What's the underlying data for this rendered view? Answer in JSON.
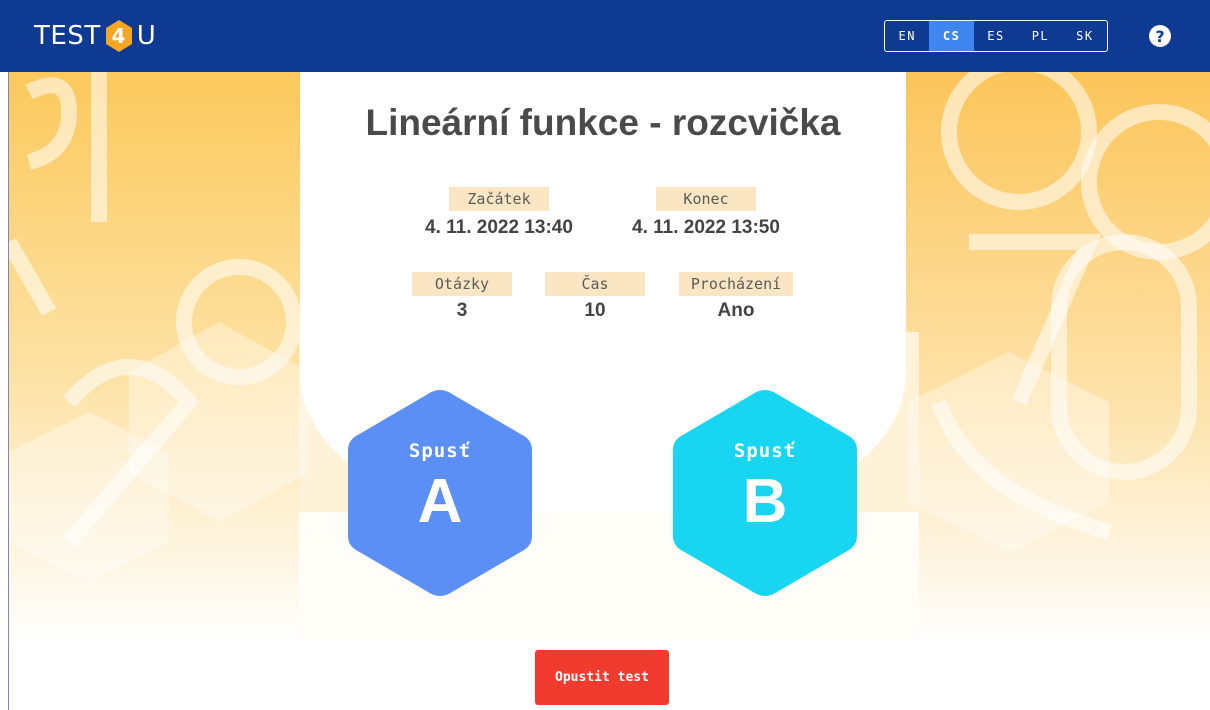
{
  "header": {
    "logo": {
      "left": "TEST",
      "digit": "4",
      "right": "U"
    },
    "languages": [
      {
        "code": "EN",
        "active": false
      },
      {
        "code": "CS",
        "active": true
      },
      {
        "code": "ES",
        "active": false
      },
      {
        "code": "PL",
        "active": false
      },
      {
        "code": "SK",
        "active": false
      }
    ],
    "help_icon": "?"
  },
  "test": {
    "title": "Lineární funkce - rozcvička",
    "start_label": "Začátek",
    "start_value": "4. 11. 2022 13:40",
    "end_label": "Konec",
    "end_value": "4. 11. 2022 13:50",
    "questions_label": "Otázky",
    "questions_value": "3",
    "time_label": "Čas",
    "time_value": "10",
    "browsing_label": "Procházení",
    "browsing_value": "Ano"
  },
  "variants": [
    {
      "label": "Spusť",
      "letter": "A",
      "color": "#5b8ff5"
    },
    {
      "label": "Spusť",
      "letter": "B",
      "color": "#18d6f2"
    }
  ],
  "actions": {
    "leave_label": "Opustit test"
  },
  "colors": {
    "topbar": "#0f3a91",
    "accent": "#3f86f0",
    "tag_bg": "#fbe6c4",
    "leave_button": "#f23b2f",
    "logo_hex": "#f5a623"
  }
}
